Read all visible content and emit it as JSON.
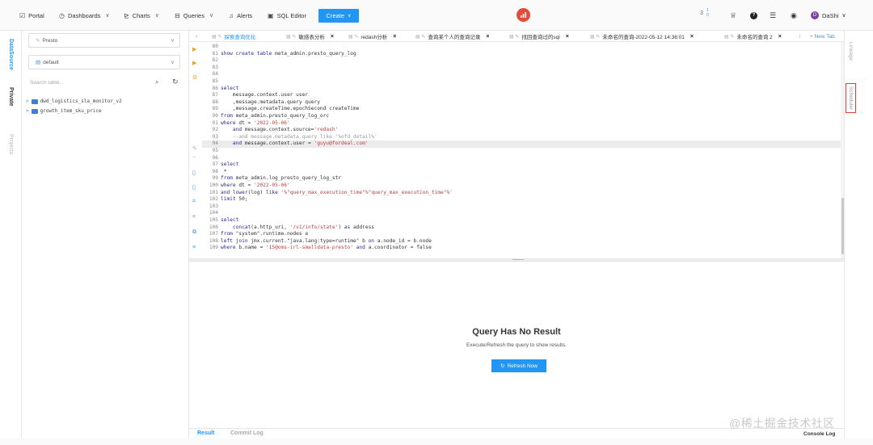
{
  "nav": {
    "portal": "Portal",
    "dashboards": "Dashboards",
    "charts": "Charts",
    "queries": "Queries",
    "alerts": "Alerts",
    "sql_editor": "SQL Editor",
    "create": "Create",
    "notif_count": "3",
    "notif_sup": "1 0",
    "user_initial": "D",
    "user_name": "DaShi"
  },
  "left_rail": {
    "datasource": "DataSource",
    "private": "Private",
    "projects": "Projects"
  },
  "schema": {
    "datasource_value": "Presto",
    "database_value": "default",
    "search_placeholder": "Search table...",
    "tables": [
      "dwd_logistics_sla_monitor_v2",
      "growth_item_sku_price"
    ]
  },
  "tabs": [
    {
      "label": "探索查询优化",
      "active": true
    },
    {
      "label": "敏感表分析"
    },
    {
      "label": "redash分析"
    },
    {
      "label": "查询某个人的查询记录"
    },
    {
      "label": "找回查询过的sql"
    },
    {
      "label": "未命名的查询-2022-05-12 14:38:01"
    },
    {
      "label": "未命名的查询 2"
    }
  ],
  "new_tab": "+ New Tab",
  "code_lines": [
    {
      "n": "80",
      "t": ""
    },
    {
      "n": "81",
      "t": "show create table meta_admin.presto_query_log"
    },
    {
      "n": "82",
      "t": ""
    },
    {
      "n": "83",
      "t": ""
    },
    {
      "n": "84",
      "t": ""
    },
    {
      "n": "85",
      "t": ""
    },
    {
      "n": "86",
      "t": "select"
    },
    {
      "n": "87",
      "t": "    message.context.user user"
    },
    {
      "n": "88",
      "t": "    ,message.metadata.query query"
    },
    {
      "n": "89",
      "t": "    ,message.createTime.epochSecond createTime"
    },
    {
      "n": "90",
      "t": "from meta_admin.presto_query_log_orc"
    },
    {
      "n": "91",
      "t": "where dt = '2022-05-06'"
    },
    {
      "n": "92",
      "t": "    and message.context.source='redash'"
    },
    {
      "n": "93",
      "t": "    --and message.metadata.query like '%ofd_detail%'"
    },
    {
      "n": "94",
      "t": "    and message.context.user = 'guyu@fordeal.com'",
      "hl": true
    },
    {
      "n": "95",
      "t": ""
    },
    {
      "n": "96",
      "t": ""
    },
    {
      "n": "97",
      "t": "select"
    },
    {
      "n": "98",
      "t": " *"
    },
    {
      "n": "99",
      "t": "from meta_admin.log_presto_query_log_str"
    },
    {
      "n": "100",
      "t": "where dt = '2022-05-06'"
    },
    {
      "n": "101",
      "t": "and lower(log) like '%\"query_max_execution_time\"%\"query_max_execution_time\"%'"
    },
    {
      "n": "102",
      "t": "limit 50;"
    },
    {
      "n": "103",
      "t": ""
    },
    {
      "n": "104",
      "t": ""
    },
    {
      "n": "105",
      "t": "select"
    },
    {
      "n": "106",
      "t": "    concat(a.http_uri, '/v1/info/state') as address"
    },
    {
      "n": "107",
      "t": "from \"system\".runtime.nodes a"
    },
    {
      "n": "108",
      "t": "left join jmx.current.\"java.lang:type=runtime\" b on a.node_id = b.node"
    },
    {
      "n": "109",
      "t": "where b.name = '15@oms-irl-smalldata-presto' and a.coordinator = false"
    }
  ],
  "result": {
    "title": "Query Has No Result",
    "subtitle": "Execute/Refresh the query to show results.",
    "refresh_label": "Refresh Now"
  },
  "bottom_tabs": {
    "result": "Result",
    "commit_log": "Commit Log",
    "console_log": "Console Log"
  },
  "right_rail": {
    "lineage": "Lineage",
    "scheduler": "Scheduler"
  },
  "watermark": "@稀土掘金技术社区",
  "colors": {
    "accent": "#2196f3",
    "logo": "#e64a3b",
    "highlight_box": "#e03c3c"
  }
}
